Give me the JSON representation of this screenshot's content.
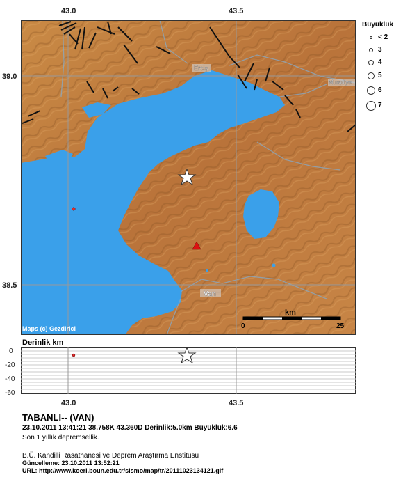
{
  "map": {
    "top_ticks": [
      "43.0",
      "43.5"
    ],
    "left_ticks": [
      "39.0",
      "38.5"
    ],
    "bottom_ticks": [
      "43.0",
      "43.5"
    ],
    "place_labels": {
      "ercis": "Erciş",
      "muradiye": "Muradiye",
      "van": "Van"
    },
    "attribution": "Maps (c) Gezdirici",
    "scale": {
      "unit": "km",
      "start": "0",
      "end": "25"
    },
    "colors": {
      "lake": "#3aa0ea",
      "land": "#c4803e",
      "fault": "#111111",
      "event_star": "#ffffff",
      "recent_dot": "#e03030",
      "station": "#dd1111"
    }
  },
  "legend": {
    "title": "Büyüklük",
    "items": [
      "< 2",
      "3",
      "4",
      "5",
      "6",
      "7"
    ]
  },
  "depth": {
    "title": "Derinlik km",
    "ticks": [
      "0",
      "-20",
      "-40",
      "-60"
    ]
  },
  "footer": {
    "title": "TABANLI-- (VAN)",
    "details": "23.10.2011 13:41:21  38.758K 43.360D  Derinlik:5.0km  Büyüklük:6.6",
    "subtitle": "Son 1 yıllık depremsellik.",
    "institute": "B.Ü. Kandilli Rasathanesi ve Deprem Araştırma Enstitüsü",
    "updated": "Güncelleme: 23.10.2011 13:52:21",
    "url": "URL: http://www.koeri.boun.edu.tr/sismo/map/tr/20111023134121.gif"
  }
}
